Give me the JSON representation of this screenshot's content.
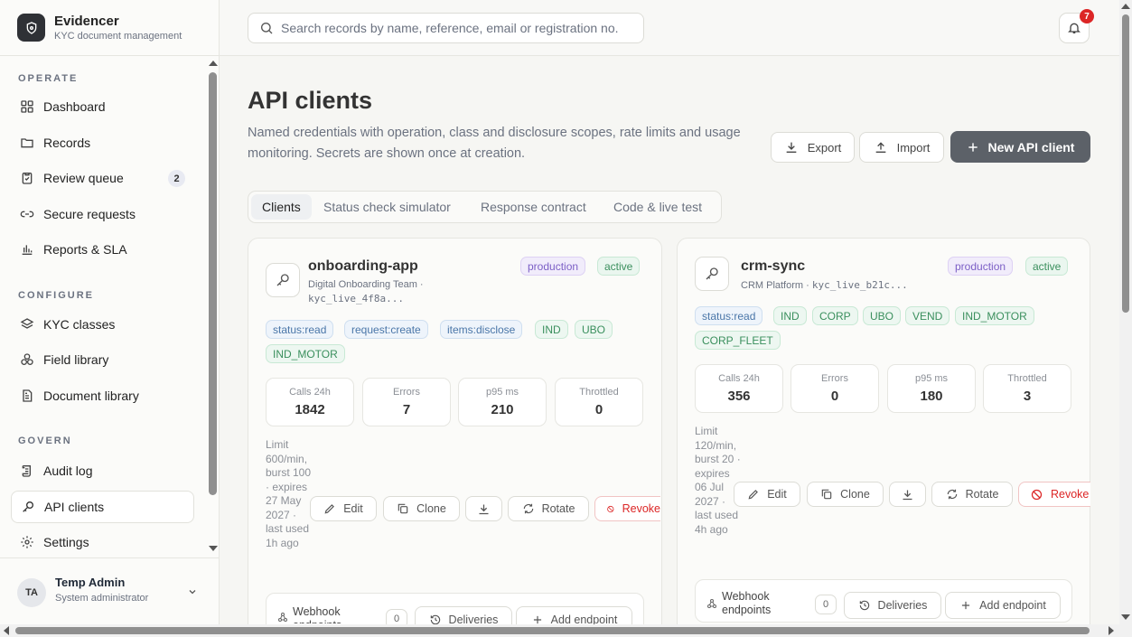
{
  "brand": {
    "name": "Evidencer",
    "subtitle": "KYC document management"
  },
  "sidebar": {
    "sections": [
      "OPERATE",
      "CONFIGURE",
      "GOVERN"
    ],
    "operate": [
      {
        "label": "Dashboard",
        "icon": "grid-icon"
      },
      {
        "label": "Records",
        "icon": "folder-icon"
      },
      {
        "label": "Review queue",
        "icon": "clipboard-icon",
        "badge": "2"
      },
      {
        "label": "Secure requests",
        "icon": "link-icon"
      },
      {
        "label": "Reports & SLA",
        "icon": "bar-chart-icon"
      }
    ],
    "configure": [
      {
        "label": "KYC classes",
        "icon": "layers-icon"
      },
      {
        "label": "Field library",
        "icon": "shapes-icon"
      },
      {
        "label": "Document library",
        "icon": "document-icon"
      }
    ],
    "govern": [
      {
        "label": "Audit log",
        "icon": "scroll-icon"
      },
      {
        "label": "API clients",
        "icon": "key-icon",
        "active": true
      },
      {
        "label": "Settings",
        "icon": "gear-icon"
      }
    ]
  },
  "user": {
    "initials": "TA",
    "name": "Temp Admin",
    "role": "System administrator"
  },
  "header": {
    "search_placeholder": "Search records by name, reference, email or registration no.",
    "notification_count": "7"
  },
  "page": {
    "title": "API clients",
    "description": "Named credentials with operation, class and disclosure scopes, rate limits and usage monitoring. Secrets are shown once at creation.",
    "export_label": "Export",
    "import_label": "Import",
    "new_label": "New API client"
  },
  "tabs": [
    "Clients",
    "Status check simulator",
    "Response contract",
    "Code & live test"
  ],
  "stat_labels": [
    "Calls 24h",
    "Errors",
    "p95 ms",
    "Throttled"
  ],
  "actions": {
    "edit": "Edit",
    "clone": "Clone",
    "rotate": "Rotate",
    "revoke": "Revoke"
  },
  "webhook": {
    "label": "Webhook endpoints",
    "deliveries": "Deliveries",
    "add": "Add endpoint"
  },
  "clients": [
    {
      "name": "onboarding-app",
      "team": "Digital Onboarding Team ·",
      "key": "kyc_live_4f8a...",
      "env": "production",
      "status": "active",
      "scopes": [
        "status:read",
        "request:create",
        "items:disclose",
        "IND",
        "UBO",
        "IND_MOTOR"
      ],
      "stats": [
        "1842",
        "7",
        "210",
        "0"
      ],
      "limit_text": "Limit 600/min, burst 100 · expires 27 May 2027 · last used 1h ago",
      "webhook_count": "0"
    },
    {
      "name": "crm-sync",
      "team": "CRM Platform ·",
      "key": "kyc_live_b21c...",
      "env": "production",
      "status": "active",
      "scopes": [
        "status:read",
        "IND",
        "CORP",
        "UBO",
        "VEND",
        "IND_MOTOR",
        "CORP_FLEET"
      ],
      "stats": [
        "356",
        "0",
        "180",
        "3"
      ],
      "limit_text": "Limit 120/min, burst 20 · expires 06 Jul 2027 · last used 4h ago",
      "webhook_count": "0"
    }
  ],
  "colors": {
    "accent": "#5c6168",
    "danger": "#dc2626",
    "production": "#7c5fc6",
    "active": "#3a8f5d"
  }
}
